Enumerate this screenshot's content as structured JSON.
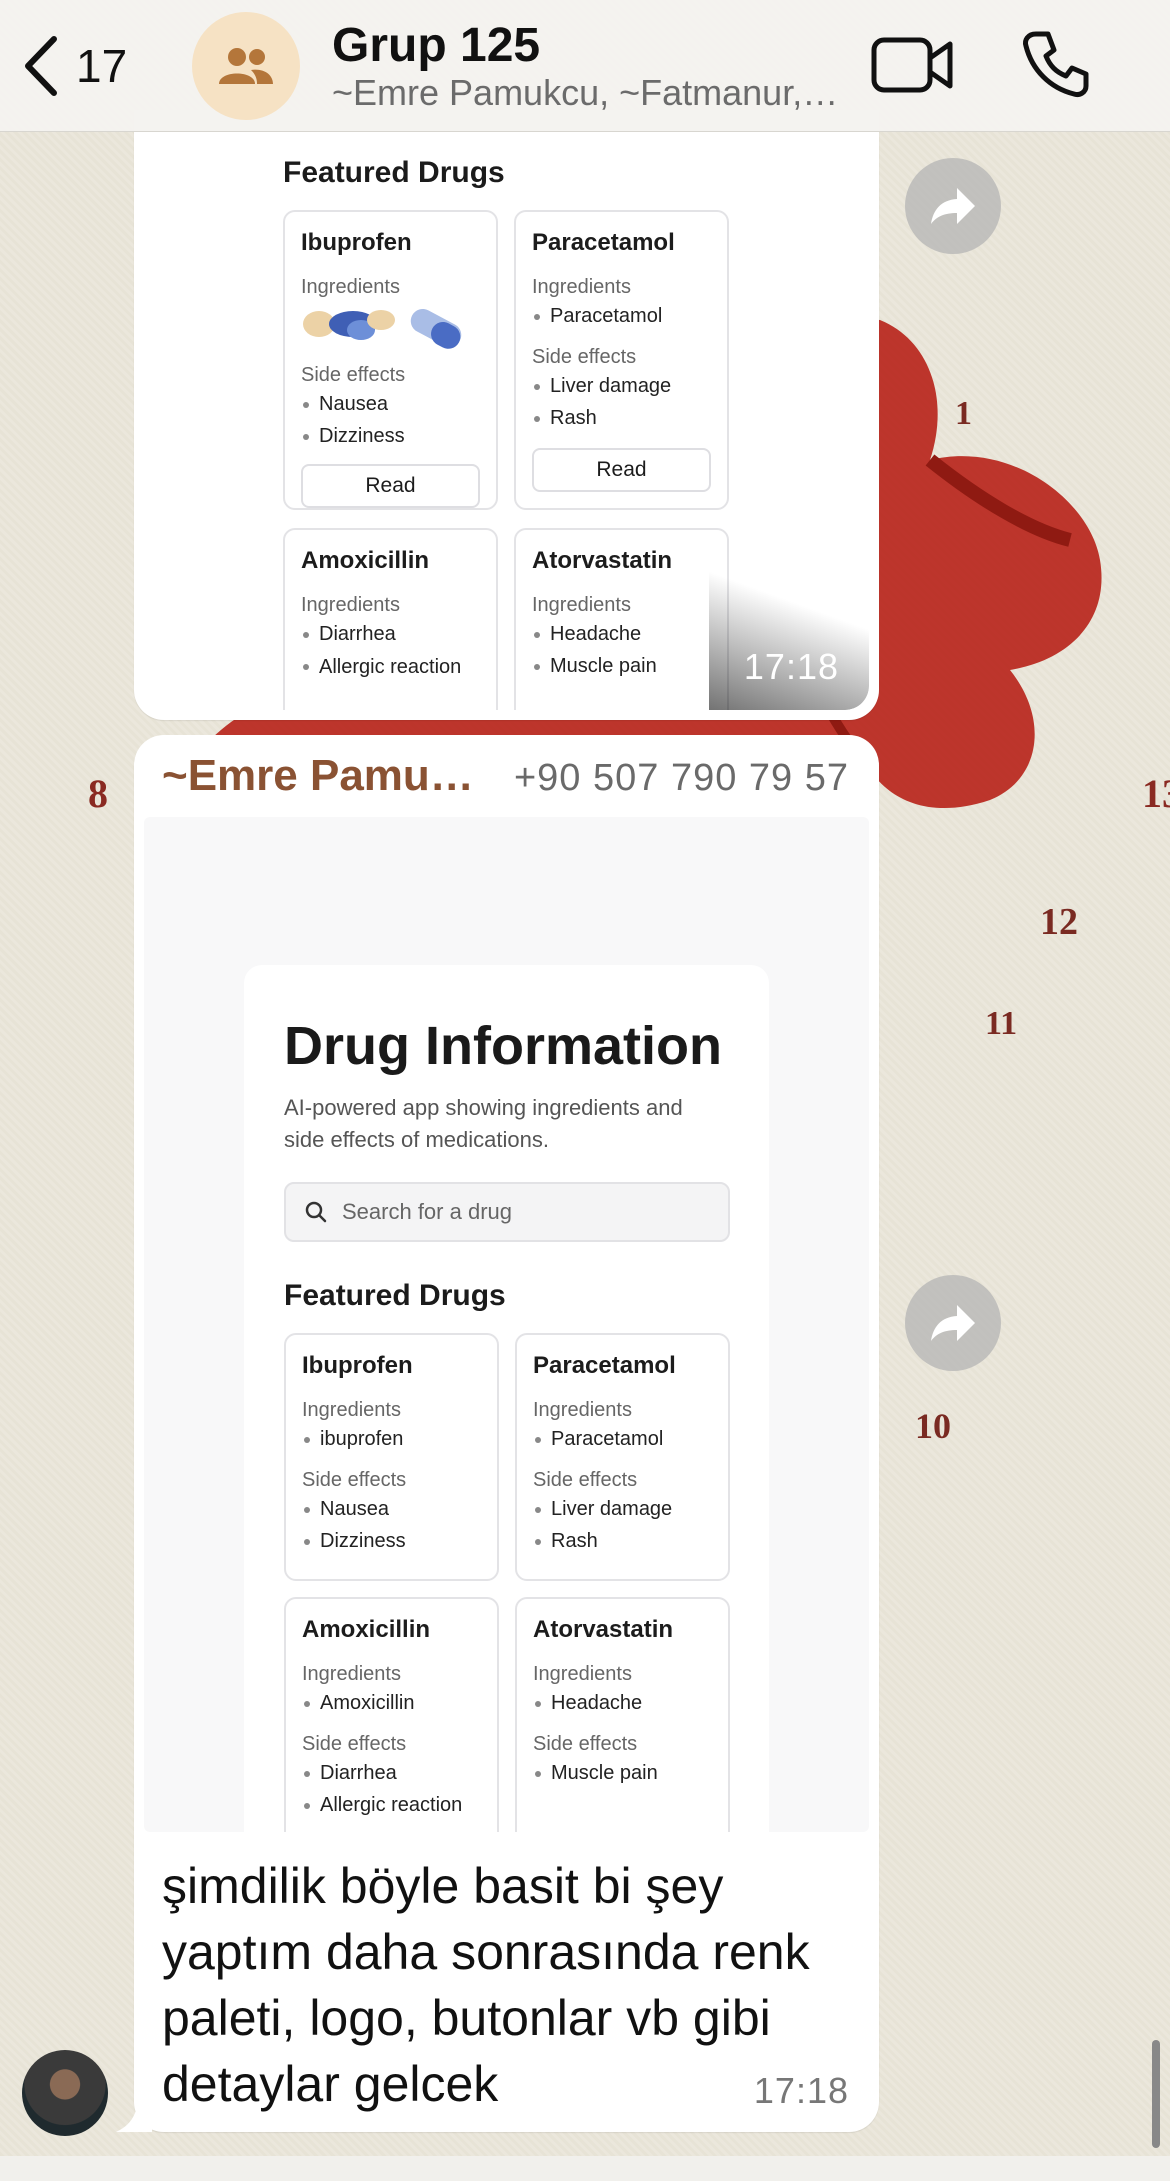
{
  "header": {
    "back_count": "17",
    "title": "Grup 125",
    "subtitle": "~Emre Pamukcu, ~Fatmanur,…"
  },
  "message1": {
    "featured_title": "Featured Drugs",
    "cards": [
      {
        "name": "Ibuprofen",
        "ingredients_label": "Ingredients",
        "side_label": "Side effects",
        "side_effects": [
          "Nausea",
          "Dizziness"
        ],
        "read": "Read"
      },
      {
        "name": "Paracetamol",
        "ingredients_label": "Ingredients",
        "ingredients": [
          "Paracetamol"
        ],
        "side_label": "Side effects",
        "side_effects": [
          "Liver damage",
          "Rash"
        ],
        "read": "Read"
      },
      {
        "name": "Amoxicillin",
        "ingredients_label": "Ingredients",
        "items": [
          "Diarrhea",
          "Allergic reaction"
        ]
      },
      {
        "name": "Atorvastatin",
        "ingredients_label": "Ingredients",
        "items": [
          "Headache",
          "Muscle pain"
        ]
      }
    ],
    "time": "17:18"
  },
  "message2": {
    "sender": "~Emre Pamu…",
    "phone": "+90 507 790 79 57",
    "app_title": "Drug Information",
    "app_subtitle": "AI-powered app showing ingredients and side effects of medications.",
    "search_placeholder": "Search for a drug",
    "featured_title": "Featured Drugs",
    "cards": [
      {
        "name": "Ibuprofen",
        "ingredients_label": "Ingredients",
        "ingredients": [
          "ibuprofen"
        ],
        "side_label": "Side effects",
        "side_effects": [
          "Nausea",
          "Dizziness"
        ]
      },
      {
        "name": "Paracetamol",
        "ingredients_label": "Ingredients",
        "ingredients": [
          "Paracetamol"
        ],
        "side_label": "Side effects",
        "side_effects": [
          "Liver damage",
          "Rash"
        ]
      },
      {
        "name": "Amoxicillin",
        "ingredients_label": "Ingredients",
        "ingredients": [
          "Amoxicillin"
        ],
        "side_label": "Side effects",
        "side_effects": [
          "Diarrhea",
          "Allergic reaction"
        ]
      },
      {
        "name": "Atorvastatin",
        "ingredients_label": "Ingredients",
        "ingredients": [
          "Headache"
        ],
        "side_label": "Side effects",
        "side_effects": [
          "Muscle pain"
        ]
      }
    ],
    "caption": "şimdilik böyle basit bi şey yaptım daha sonrasında renk paleti, logo, butonlar vb gibi detaylar gelcek",
    "time": "17:18"
  },
  "wallpaper_labels": [
    "1",
    "8",
    "12",
    "11",
    "10",
    "13"
  ],
  "colors": {
    "sender": "#8a5233",
    "wallpaper_heart": "#b8261c",
    "avatar_bg": "#f6e2c4"
  }
}
